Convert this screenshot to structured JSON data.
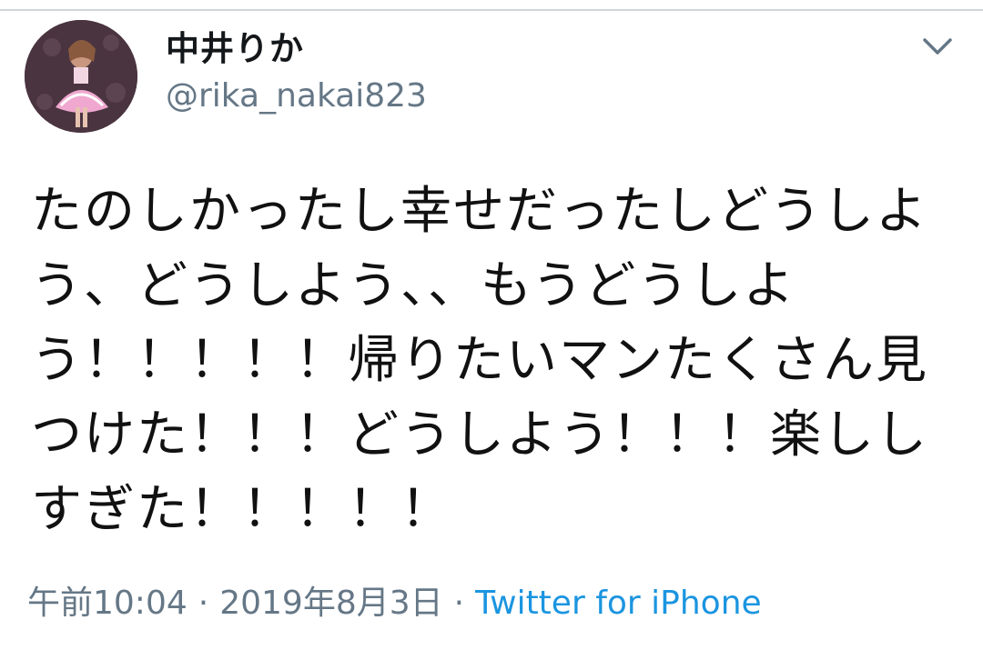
{
  "tweet": {
    "author": {
      "display_name": "中井りか",
      "handle": "@rika_nakai823",
      "avatar_icon": "profile-photo"
    },
    "menu_icon": "chevron-down-icon",
    "text": "たのしかったし幸せだったしどうしよう、どうしよう、、もうどうしよう！！！！！帰りたいマンたくさん見つけた！！！どうしよう！！！楽ししすぎた！！！！！",
    "time": "午前10:04",
    "date": "2019年8月3日",
    "separator": "·",
    "source": "Twitter for iPhone"
  },
  "colors": {
    "text_primary": "#14171a",
    "text_secondary": "#657786",
    "link": "#1b95e0",
    "divider": "#cfd6dc"
  }
}
